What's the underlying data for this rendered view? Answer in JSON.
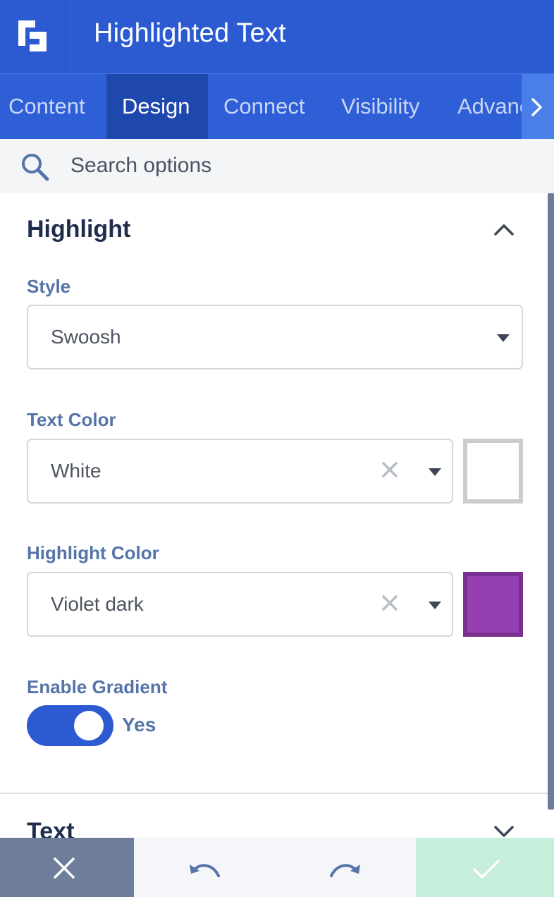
{
  "app": {
    "title": "Highlighted Text"
  },
  "tabs": [
    {
      "label": "Content",
      "active": false
    },
    {
      "label": "Design",
      "active": true
    },
    {
      "label": "Connect",
      "active": false
    },
    {
      "label": "Visibility",
      "active": false
    },
    {
      "label": "Advanced",
      "active": false
    }
  ],
  "search": {
    "placeholder": "Search options"
  },
  "sections": {
    "highlight": {
      "title": "Highlight",
      "expanded": true,
      "style": {
        "label": "Style",
        "value": "Swoosh"
      },
      "text_color": {
        "label": "Text Color",
        "value": "White",
        "swatch": "#ffffff"
      },
      "highlight_color": {
        "label": "Highlight Color",
        "value": "Violet dark",
        "swatch": "#9440b3"
      },
      "gradient": {
        "label": "Enable Gradient",
        "state": "Yes",
        "on": true
      }
    },
    "text": {
      "title": "Text",
      "expanded": false
    }
  },
  "colors": {
    "primary": "#2b5ad1",
    "active_tab": "#1e48ad",
    "save": "#c5eedb",
    "cancel": "#6e7d99"
  },
  "icons": [
    "logo-icon",
    "chevron-right-icon",
    "search-icon",
    "chevron-up-icon",
    "caret-down-icon",
    "clear-icon",
    "chevron-down-icon",
    "close-icon",
    "undo-icon",
    "redo-icon",
    "check-icon"
  ]
}
